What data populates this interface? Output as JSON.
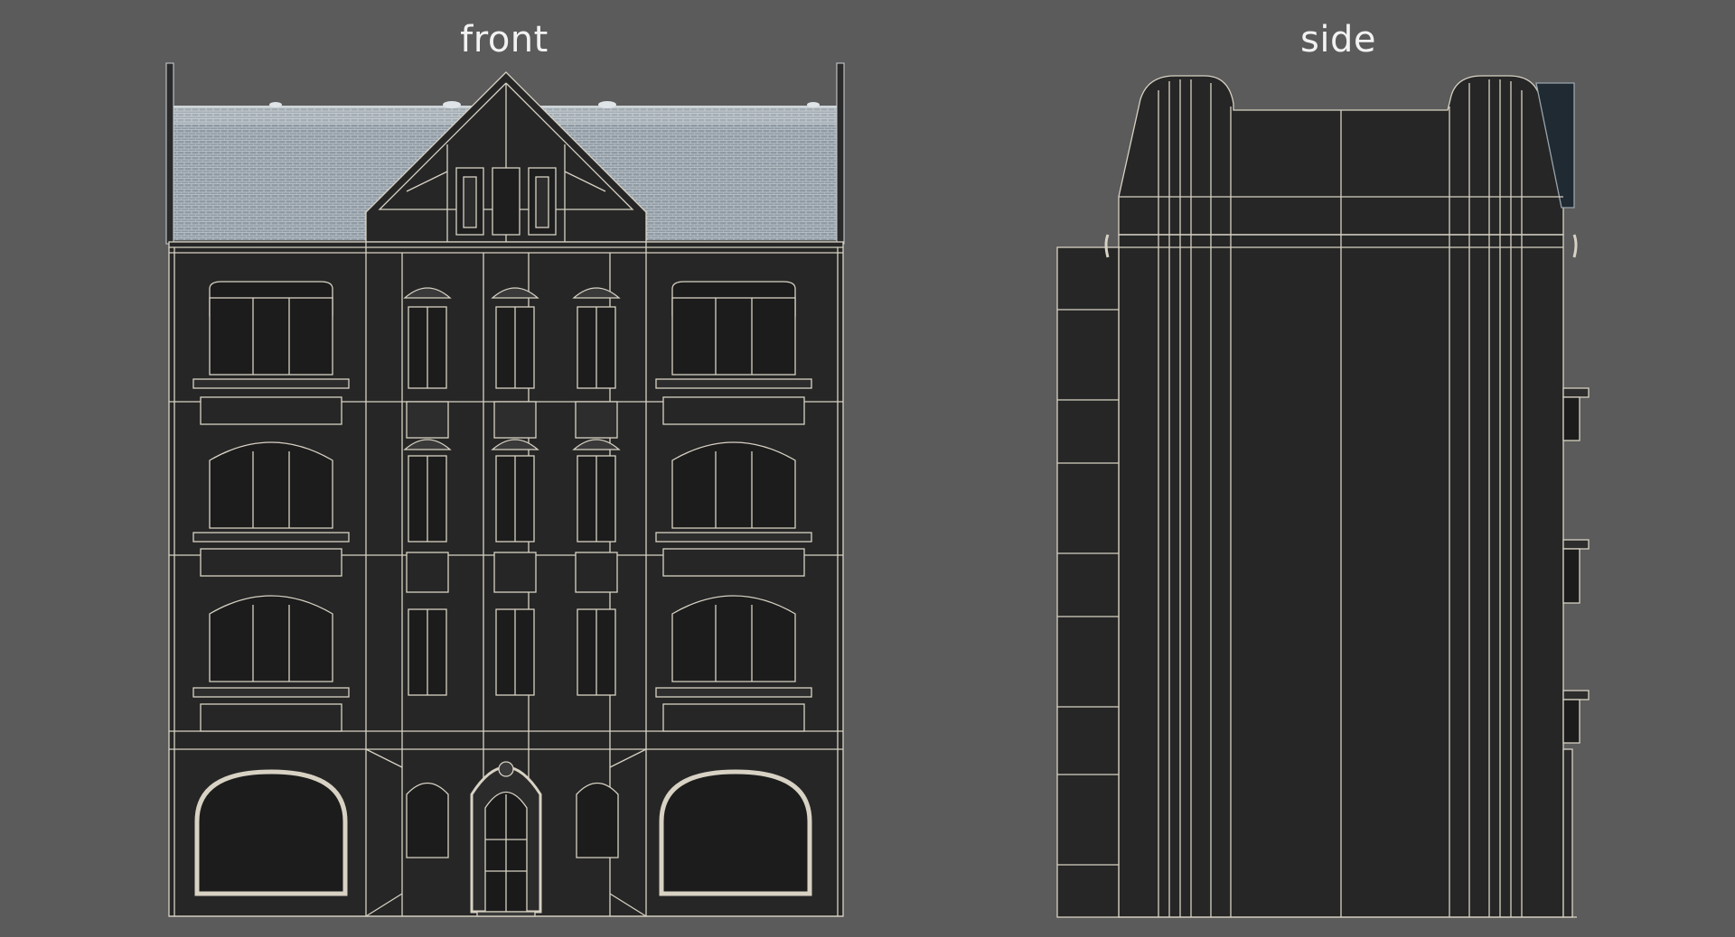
{
  "views": {
    "front_label": "front",
    "side_label": "side"
  },
  "colors": {
    "background": "#5b5b5b",
    "wall": "#262626",
    "wire": "#d8d2c4",
    "roof": "#9aa4ac",
    "roof_line": "#c9cfd4",
    "label": "#f2f2f2"
  },
  "front": {
    "floors": 4,
    "window_bays": 5,
    "balcony_levels": 3,
    "garage_arches": 2
  },
  "side": {
    "floors": 4,
    "side_balconies": 3
  }
}
